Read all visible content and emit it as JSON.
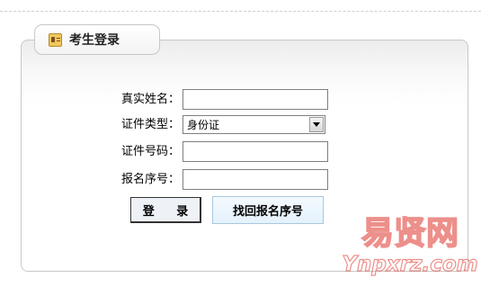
{
  "panel": {
    "title": "考生登录",
    "title_icon": "id-card-icon"
  },
  "form": {
    "name_label": "真实姓名：",
    "name_value": "",
    "id_type_label": "证件类型：",
    "id_type_value": "身份证",
    "id_number_label": "证件号码：",
    "id_number_value": "",
    "reg_number_label": "报名序号：",
    "reg_number_value": ""
  },
  "buttons": {
    "login": "登 录",
    "recover": "找回报名序号"
  },
  "watermark": {
    "text": "易贤网",
    "url": "Ynpxrz.com"
  },
  "colors": {
    "watermark": "#e0342c",
    "panel_border": "#c8c8c8"
  }
}
